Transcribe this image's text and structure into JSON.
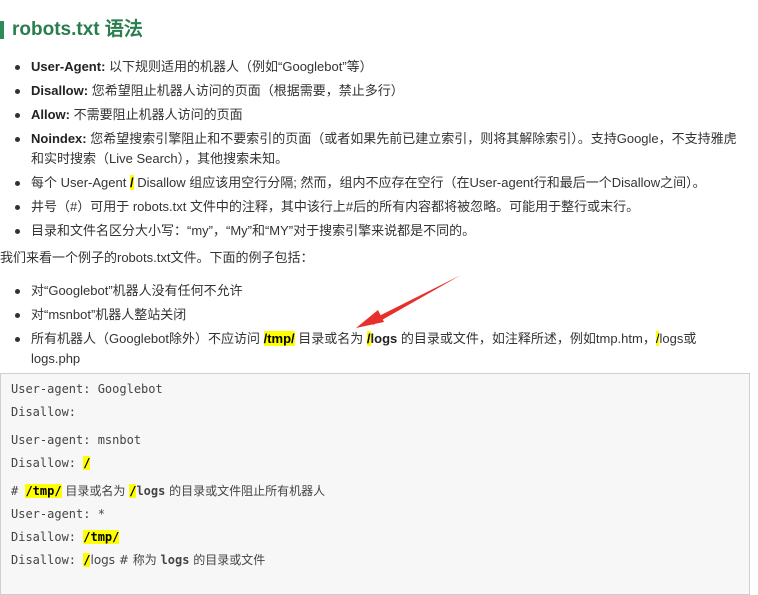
{
  "heading": "robots.txt 语法",
  "list1": [
    {
      "key": "User-Agent:",
      "text": " 以下规则适用的机器人（例如“Googlebot”等）"
    },
    {
      "key": "Disallow:",
      "text": " 您希望阻止机器人访问的页面（根据需要，禁止多行）"
    },
    {
      "key": "Allow:",
      "text": " 不需要阻止机器人访问的页面"
    },
    {
      "key": "Noindex:",
      "text": " 您希望搜索引擎阻止和不要索引的页面（或者如果先前已建立索引，则将其解除索引）。支持Google，不支持雅虎和实时搜索（Live Search），其他搜索未知。"
    },
    {
      "pre": "每个 User-Agent ",
      "hl": "/",
      "post": " Disallow 组应该用空行分隔; 然而，组内不应存在空行（在User-agent行和最后一个Disallow之间）。"
    },
    {
      "text": "井号（#）可用于 robots.txt 文件中的注释，其中该行上#后的所有内容都将被忽略。可能用于整行或末行。"
    },
    {
      "text": "目录和文件名区分大小写：“my”，“My”和“MY”对于搜索引擎来说都是不同的。"
    }
  ],
  "para": "我们来看一个例子的robots.txt文件。下面的例子包括：",
  "list2": [
    {
      "text": "对“Googlebot”机器人没有任何不允许"
    },
    {
      "text": "对“msnbot”机器人整站关闭"
    },
    {
      "p1": "所有机器人（Googlebot除外）不应访问 ",
      "h1": "/tmp/",
      "p2": " 目录或名为 ",
      "h2": "/",
      "p3": "logs",
      "p4": " 的目录或文件，如注释所述，例如tmp.htm，",
      "h3": "/",
      "p5": "logs或logs.php"
    }
  ],
  "code": {
    "l1": "User-agent: Googlebot",
    "l2": "Disallow:",
    "l3": "User-agent: msnbot",
    "l4_pre": "Disallow: ",
    "l4_hl": "/",
    "l5_pre": "# ",
    "l5_hl1": "/tmp/",
    "l5_mid": " 目录或名为 ",
    "l5_hl2": "/",
    "l5_logs": "logs",
    "l5_post": " 的目录或文件阻止所有机器人",
    "l6": "User-agent: *",
    "l7_pre": "Disallow: ",
    "l7_hl": "/tmp/",
    "l8_pre": "Disallow: ",
    "l8_hl": "/",
    "l8_mid": "logs # 称为 ",
    "l8_logs": "logs",
    "l8_post": " 的目录或文件"
  },
  "colors": {
    "heading": "#2a7d4f",
    "highlight": "#ffff00",
    "arrow": "#e8302a"
  }
}
